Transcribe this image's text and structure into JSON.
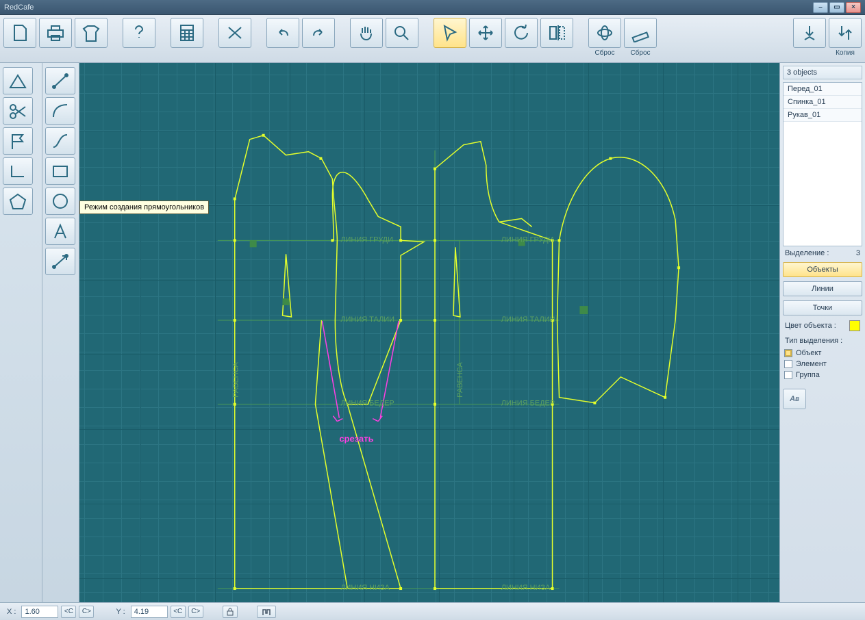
{
  "title": "RedCafe",
  "toolbar": {
    "reset1": "Сброс",
    "reset2": "Сброс",
    "copy": "Копия"
  },
  "tooltip": "Режим создания прямоугольников",
  "canvas": {
    "labels": {
      "chest1": "ЛИНИЯ  ГРУДИ",
      "chest2": "ЛИНИЯ  ГРУДИ",
      "waist1": "ЛИНИЯ  ТАЛИИ",
      "waist2": "ЛИНИЯ  ТАЛИИ",
      "hip1": "ЛИНИЯ  БЕДЕР",
      "hip2": "ЛИНИЯ  БЕДЕР",
      "hem1": "ЛИНИЯ  НИЗА",
      "hem2": "ЛИНИЯ  НИЗА",
      "balance1": "РАВЕНСА",
      "balance2": "РАВЕНСА",
      "cut": "срезать"
    }
  },
  "right": {
    "count_label": "3 objects",
    "items": [
      "Перед_01",
      "Спинка_01",
      "Рукав_01"
    ],
    "sel_label": "Выделение :",
    "sel_count": "3",
    "btns": {
      "objects": "Объекты",
      "lines": "Линии",
      "points": "Точки"
    },
    "color_label": "Цвет объекта :",
    "seltype_label": "Тип выделения :",
    "checks": {
      "object": "Объект",
      "element": "Элемент",
      "group": "Группа"
    }
  },
  "status": {
    "xlab": "X :",
    "x": "1.60",
    "ylab": "Y :",
    "y": "4.19",
    "cbtn": "<C",
    "cbtn2": "C>"
  }
}
